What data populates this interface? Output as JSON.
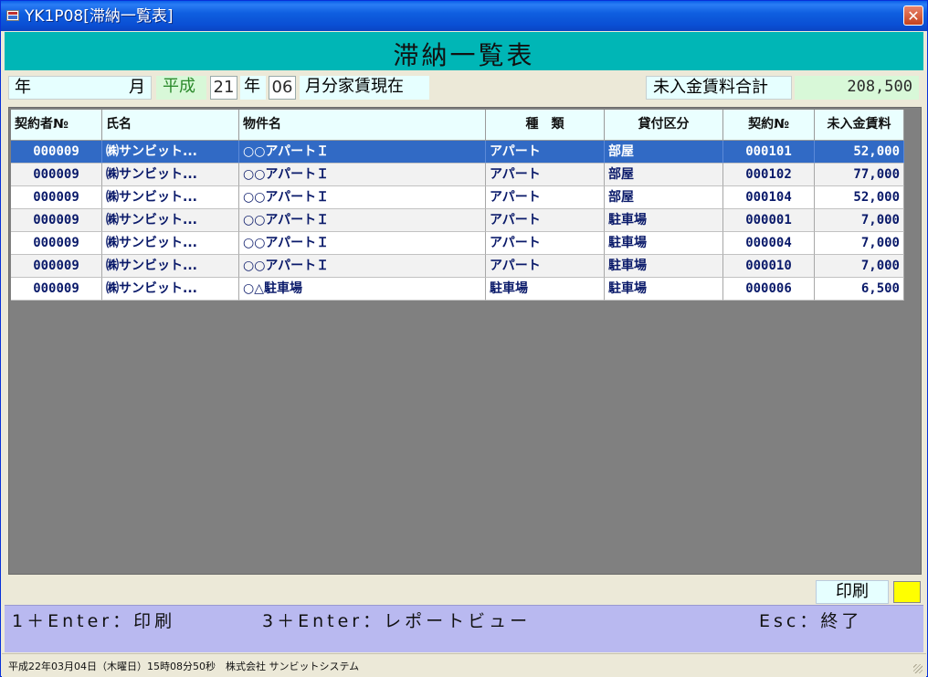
{
  "window": {
    "title": "YK1P08[滞納一覧表]",
    "close_glyph": "✕"
  },
  "banner": {
    "title": "滞納一覧表"
  },
  "criteria": {
    "year_label": "年",
    "month_label": "月",
    "era": "平成",
    "year_value": "21",
    "year_suffix": "年",
    "month_value": "06",
    "month_suffix": "月分家賃現在",
    "total_label": "未入金賃料合計",
    "total_value": "208,500"
  },
  "table": {
    "headers": [
      "契約者№",
      "氏名",
      "物件名",
      "種　類",
      "貸付区分",
      "契約№",
      "未入金賃料"
    ],
    "rows": [
      [
        "000009",
        "㈱サンビット...",
        "○○アパートＩ",
        "アパート",
        "部屋",
        "000101",
        "52,000"
      ],
      [
        "000009",
        "㈱サンビット...",
        "○○アパートＩ",
        "アパート",
        "部屋",
        "000102",
        "77,000"
      ],
      [
        "000009",
        "㈱サンビット...",
        "○○アパートＩ",
        "アパート",
        "部屋",
        "000104",
        "52,000"
      ],
      [
        "000009",
        "㈱サンビット...",
        "○○アパートＩ",
        "アパート",
        "駐車場",
        "000001",
        "7,000"
      ],
      [
        "000009",
        "㈱サンビット...",
        "○○アパートＩ",
        "アパート",
        "駐車場",
        "000004",
        "7,000"
      ],
      [
        "000009",
        "㈱サンビット...",
        "○○アパートＩ",
        "アパート",
        "駐車場",
        "000010",
        "7,000"
      ],
      [
        "000009",
        "㈱サンビット...",
        "○△駐車場",
        "駐車場",
        "駐車場",
        "000006",
        "6,500"
      ]
    ],
    "selected_row": 0
  },
  "print_indicator": {
    "label": "印刷",
    "color": "#ffff00"
  },
  "function_keys": {
    "print": "1＋Enter：印刷",
    "report_view": "3＋Enter：レポートビュー",
    "exit": "Esc：終了"
  },
  "statusbar": {
    "text": "平成22年03月04日（木曜日）15時08分50秒　株式会社 サンビットシステム"
  }
}
